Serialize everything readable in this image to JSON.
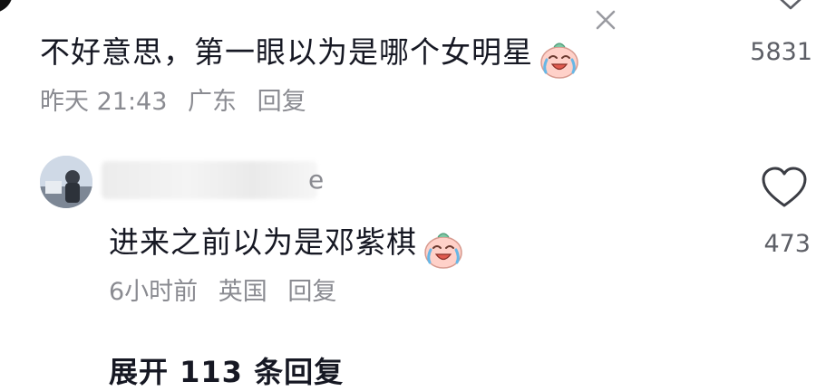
{
  "comment1": {
    "text": "不好意思，第一眼以为是哪个女明星",
    "time": "昨天 21:43",
    "location": "广东",
    "reply": "回复",
    "like_count": "5831",
    "emoji": "laugh-cry-emoji"
  },
  "comment2": {
    "username_suffix": "e",
    "text": "进来之前以为是邓紫棋",
    "time": "6小时前",
    "location": "英国",
    "reply": "回复",
    "like_count": "473",
    "emoji": "laugh-cry-emoji"
  },
  "footer": {
    "expand_label": "展开 113 条回复"
  },
  "icons": [
    "close-icon",
    "chevron-down-icon",
    "heart-icon",
    "avatar"
  ],
  "colors": {
    "text_primary": "#161823",
    "text_secondary": "#8a8b91",
    "background": "#ffffff"
  }
}
